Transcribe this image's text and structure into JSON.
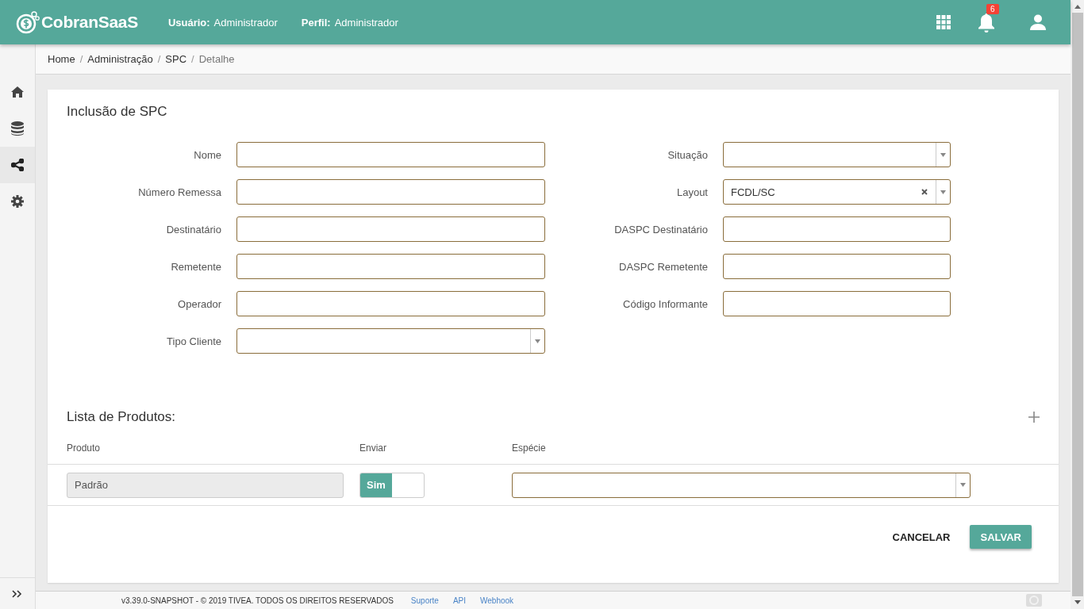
{
  "header": {
    "logo": "CobranSaaS",
    "user_label": "Usuário:",
    "user": "Administrador",
    "profile_label": "Perfil:",
    "profile": "Administrador",
    "notifications": "6"
  },
  "sidebar": {
    "items": [
      {
        "selected": false
      },
      {
        "selected": false
      },
      {
        "selected": true
      },
      {
        "selected": false
      }
    ]
  },
  "breadcrumb": {
    "separator": "/",
    "items": [
      {
        "label": "Home",
        "current": false
      },
      {
        "label": "Administração",
        "current": false
      },
      {
        "label": "SPC",
        "current": false
      },
      {
        "label": "Detalhe",
        "current": true
      }
    ]
  },
  "form": {
    "title": "Inclusão de SPC",
    "left_fields": [
      {
        "label": "Nome",
        "kind": "text"
      },
      {
        "label": "Número Remessa",
        "kind": "text"
      },
      {
        "label": "Destinatário",
        "kind": "text"
      },
      {
        "label": "Remetente",
        "kind": "text"
      },
      {
        "label": "Operador",
        "kind": "text"
      },
      {
        "label": "Tipo Cliente",
        "kind": "select"
      }
    ],
    "right_fields": [
      {
        "label": "Situação",
        "kind": "select"
      },
      {
        "label": "Layout",
        "kind": "select",
        "value": "FCDL/SC"
      },
      {
        "label": "DASPC Destinatário",
        "kind": "text"
      },
      {
        "label": "DASPC Remetente",
        "kind": "text"
      },
      {
        "label": "Código Informante",
        "kind": "text"
      }
    ]
  },
  "products": {
    "title": "Lista de Produtos:",
    "columns": [
      "Produto",
      "Enviar",
      "Espécie"
    ],
    "rows": [
      {
        "produto": {
          "value": "Padrão",
          "disabled": true
        },
        "enviar": {
          "label": "Sim",
          "on": true
        },
        "especie": {
          "kind": "select"
        }
      }
    ]
  },
  "buttons": [
    {
      "label": "CANCELAR",
      "kind": "flat"
    },
    {
      "label": "SALVAR",
      "kind": "raised"
    }
  ],
  "footer": {
    "text": "v3.39.0-SNAPSHOT - © 2019 TIVEA. TODOS OS DIREITOS RESERVADOS",
    "links": [
      "Suporte",
      "API",
      "Webhook"
    ]
  }
}
